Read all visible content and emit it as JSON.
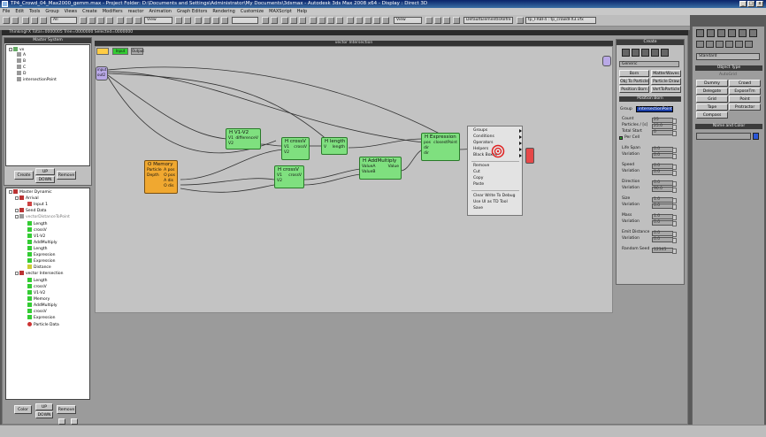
{
  "window": {
    "title": "TP4_Crowd_04_Max2000_gemm.max   - Project Folder: D:\\Documents and Settings\\Administrator\\My Documents\\3dsmax   - Autodesk 3ds Max 2008 x64   - Display : Direct 3D"
  },
  "menu": [
    "File",
    "Edit",
    "Tools",
    "Group",
    "Views",
    "Create",
    "Modifiers",
    "reactor",
    "Animation",
    "Graph Editors",
    "Rendering",
    "Customize",
    "MAXScript",
    "Help"
  ],
  "toolbar": {
    "view_field": "View",
    "view_field_2": "View",
    "selection_field": "DefaultElementIsRefre",
    "named_field": "tp_FRBF4 : tp_crowdFX3.vfx"
  },
  "thinking": {
    "title": "ThinkingFX",
    "status": "Total=0000005   Tree=0000000   Selected=0000000"
  },
  "master_system": {
    "title": "Master System",
    "items": [
      "vx",
      "A",
      "B",
      "C",
      "D",
      "intersectionPoint"
    ],
    "buttons": {
      "create": "Create",
      "up": "UP",
      "down": "DOWN",
      "remove": "Remove"
    }
  },
  "dynamics": {
    "items": [
      "Master Dynamic",
      "Arrival",
      "Input 1",
      "Send Data",
      "vectorDistanceToPoint",
      "Length",
      "crossV",
      "V1-V2",
      "AddMultiply",
      "Length",
      "Expression",
      "Expression",
      "Distance",
      "vector Intersection",
      "Length",
      "crossV",
      "V1-V2",
      "Memory",
      "AddMultiply",
      "crossV",
      "Expression",
      "Particle Data"
    ],
    "buttons": {
      "create": "Create",
      "up": "UP",
      "down": "DOWN",
      "remove": "Remove"
    }
  },
  "canvas": {
    "title": "vector Intersection",
    "top_tabs": [
      "",
      "Input",
      "Output"
    ],
    "left_node_ports": [
      "input",
      "out2"
    ]
  },
  "nodes": {
    "v1v2": {
      "title": "H V1-V2",
      "in": [
        "V1",
        "V2"
      ],
      "out": [
        "differenceV"
      ]
    },
    "crossv1": {
      "title": "H crossV",
      "in": [
        "V1",
        "V2"
      ],
      "out": [
        "crossV"
      ]
    },
    "length": {
      "title": "H length",
      "in": [
        "V"
      ],
      "out": [
        "length"
      ]
    },
    "expression": {
      "title": "H Expression",
      "in": [
        "pos",
        "dir",
        "dir"
      ],
      "out": [
        "closestPoint"
      ]
    },
    "memory": {
      "title": "O Memory",
      "in": [
        "Particle",
        "Depth"
      ],
      "out": [
        "A pos",
        "O pos",
        "A dis",
        "O dis"
      ]
    },
    "crossv2": {
      "title": "H crossV",
      "in": [
        "V1",
        "V2"
      ],
      "out": [
        "crossV"
      ]
    },
    "addmul": {
      "title": "H AddMultiply",
      "in": [
        "ValueA",
        "ValueB"
      ],
      "out": [
        "Value"
      ]
    }
  },
  "context_menu": {
    "items": [
      "Groups",
      "Conditions",
      "Operators",
      "Helpers",
      "Black Boxes",
      "Remove",
      "Cut",
      "Copy",
      "Paste",
      "Clear Write To Debug",
      "Use UI as TD Tool",
      "Save"
    ]
  },
  "create_panel": {
    "title": "Create",
    "category": "Generic",
    "buttons": [
      "Born",
      "MatterWaves",
      "Obj To Particle",
      "Particle Draw",
      "Position Born",
      "VertToParticle"
    ],
    "position_born": "Position Born",
    "group_label": "Group",
    "group_value": "intersectionPoint",
    "fields": [
      {
        "label": "Count",
        "value": "25"
      },
      {
        "label": "Particles / [s]",
        "value": "25.0"
      },
      {
        "label": "Total Start",
        "value": "0"
      },
      {
        "label": "Per Cell",
        "value": ""
      },
      {
        "label": "Life Span",
        "value": "0.0"
      },
      {
        "label": "Variation",
        "value": "0.0"
      },
      {
        "label": "Speed",
        "value": "0.0"
      },
      {
        "label": "Variation",
        "value": "0.0"
      },
      {
        "label": "Direction",
        "value": "0.0"
      },
      {
        "label": "Variation",
        "value": "90.0"
      },
      {
        "label": "Size",
        "value": "1.0"
      },
      {
        "label": "Variation",
        "value": "0.0"
      },
      {
        "label": "Mass",
        "value": "1.0"
      },
      {
        "label": "Variation",
        "value": "0.0"
      },
      {
        "label": "Emit Distance",
        "value": "0.0"
      },
      {
        "label": "Variation",
        "value": "0.0"
      },
      {
        "label": "Random Seed",
        "value": "12345"
      }
    ]
  },
  "command_panel": {
    "dropdown": "Standard",
    "object_type_title": "Object Type",
    "autogrid": "AutoGrid",
    "buttons": [
      "Dummy",
      "Crowd",
      "Delegate",
      "ExposeTm",
      "Grid",
      "Point",
      "Tape",
      "Protractor",
      "Compass"
    ],
    "name_color_title": "Name and Color"
  },
  "status": {
    "left_buttons": [
      "Color",
      "UP",
      "Remove",
      "DOWN"
    ]
  }
}
